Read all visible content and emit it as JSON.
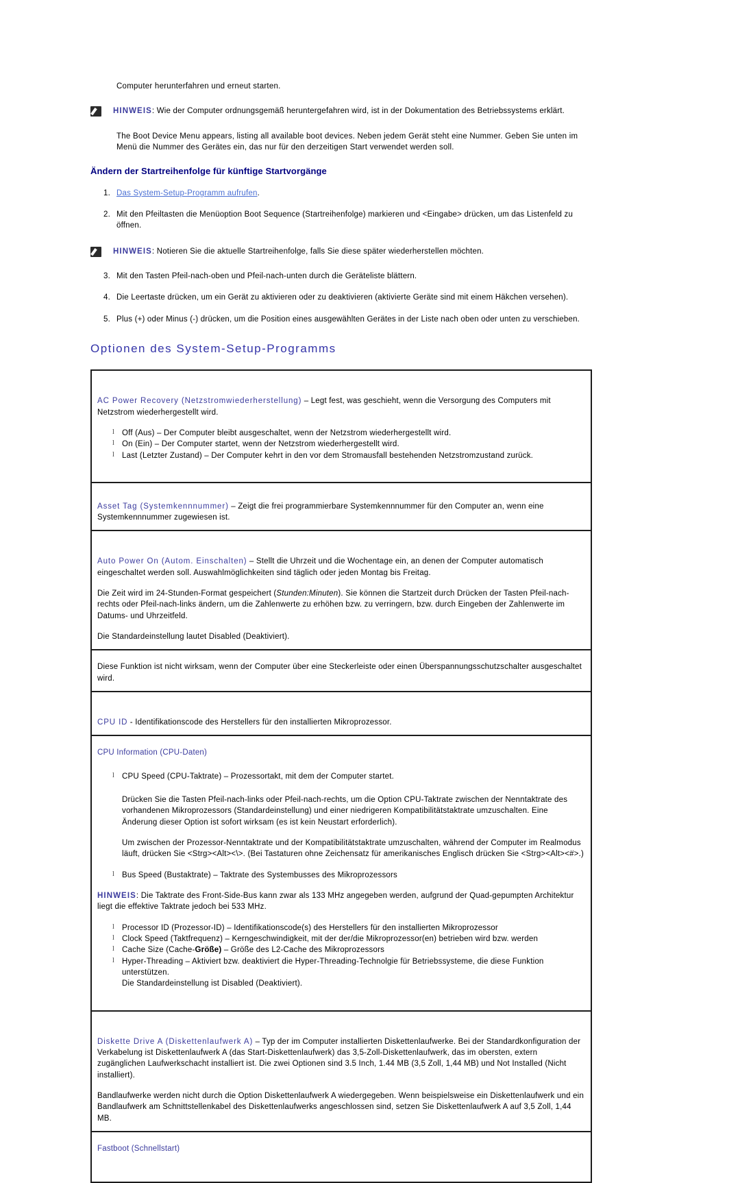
{
  "intro": {
    "shutdown_line": "Computer herunterfahren und erneut starten.",
    "note_label": "HINWEIS",
    "note_1": ": Wie der Computer ordnungsgemäß heruntergefahren wird, ist in der Dokumentation des Betriebssystems erklärt.",
    "boot_menu_para": "The Boot Device Menu appears, listing all available boot devices. Neben jedem Gerät steht eine Nummer. Geben Sie unten im Menü die Nummer des Gerätes ein, das nur für den derzeitigen Start verwendet werden soll."
  },
  "sub_heading": "Ändern der Startreihenfolge für künftige Startvorgänge",
  "steps": [
    {
      "num": "1.",
      "link": "Das System-Setup-Programm aufrufen",
      "after_link": "."
    },
    {
      "num": "2.",
      "text": "Mit den Pfeiltasten die Menüoption Boot Sequence (Startreihenfolge) markieren und <Eingabe> drücken, um das Listenfeld zu öffnen."
    },
    {
      "num": "3.",
      "text": "Mit den Tasten Pfeil-nach-oben und Pfeil-nach-unten durch die Geräteliste blättern."
    },
    {
      "num": "4.",
      "text": "Die Leertaste drücken, um ein Gerät zu aktivieren oder zu deaktivieren (aktivierte Geräte sind mit einem Häkchen versehen)."
    },
    {
      "num": "5.",
      "text": "Plus (+) oder Minus (-) drücken, um die Position eines ausgewählten Gerätes in der Liste nach oben oder unten zu verschieben."
    }
  ],
  "note_2": {
    "label": "HINWEIS",
    "text": ": Notieren Sie die aktuelle Startreihenfolge, falls Sie diese später wiederherstellen möchten."
  },
  "main_heading": "Optionen des System-Setup-Programms",
  "options": {
    "ac_power_recovery": {
      "term": "AC Power Recovery (Netzstromwiederherstellung)",
      "desc": " – Legt fest, was geschieht, wenn die Versorgung des Computers mit Netzstrom wiederhergestellt wird.",
      "bullets": [
        "Off (Aus) – Der Computer bleibt ausgeschaltet, wenn der Netzstrom wiederhergestellt wird.",
        "On (Ein) – Der Computer startet, wenn der Netzstrom wiederhergestellt wird.",
        "Last (Letzter Zustand) – Der Computer kehrt in den vor dem Stromausfall bestehenden Netzstromzustand zurück."
      ]
    },
    "asset_tag": {
      "term": "Asset Tag (Systemkennnummer)",
      "desc": " – Zeigt die frei programmierbare Systemkennnummer für den Computer an, wenn eine Systemkennnummer zugewiesen ist."
    },
    "auto_power_on": {
      "term": "Auto Power On (Autom. Einschalten)",
      "desc": " – Stellt die Uhrzeit und die Wochentage ein, an denen der Computer automatisch eingeschaltet werden soll. Auswahlmöglichkeiten sind täglich oder jeden Montag bis Freitag.",
      "para_time_a": "Die Zeit wird im 24-Stunden-Format gespeichert (",
      "para_time_em": "Stunden:Minuten",
      "para_time_b": "). Sie können die Startzeit durch Drücken der Tasten Pfeil-nach-rechts oder Pfeil-nach-links ändern, um die Zahlenwerte zu erhöhen bzw. zu verringern, bzw. durch Eingeben der Zahlenwerte im Datums- und Uhrzeitfeld.",
      "para_default": "Die Standardeinstellung lautet Disabled (Deaktiviert).",
      "para_surge": "Diese Funktion ist nicht wirksam, wenn der Computer über eine Steckerleiste oder einen Überspannungsschutzschalter ausgeschaltet wird."
    },
    "cpu_id": {
      "term": "CPU ID",
      "desc": " - Identifikationscode des Herstellers für den installierten Mikroprozessor."
    },
    "cpu_information": {
      "term": "CPU Information (CPU-Daten)",
      "bullet_cpu_speed": "CPU Speed (CPU-Taktrate) – Prozessortakt, mit dem der Computer startet.",
      "para_switch_1": "Drücken Sie die Tasten Pfeil-nach-links oder Pfeil-nach-rechts, um die Option CPU-Taktrate zwischen der Nenntaktrate des vorhandenen Mikroprozessors (Standardeinstellung) und einer niedrigeren Kompatibilitätstaktrate umzuschalten. Eine Änderung dieser Option ist sofort wirksam (es ist kein Neustart erforderlich).",
      "para_switch_2": "Um zwischen der Prozessor-Nenntaktrate und der Kompatibilitätstaktrate umzuschalten, während der Computer im Realmodus läuft, drücken Sie <Strg><Alt><\\>. (Bei Tastaturen ohne Zeichensatz für amerikanisches Englisch drücken Sie <Strg><Alt><#>.)",
      "bullet_bus_speed": "Bus Speed (Bustaktrate) – Taktrate des Systembusses des Mikroprozessors",
      "note_label": "HINWEIS",
      "note_text": ": Die Taktrate des Front-Side-Bus kann zwar als 133 MHz angegeben werden, aufgrund der Quad-gepumpten Architektur liegt die effektive Taktrate jedoch bei 533 MHz.",
      "bullets_tail": [
        "Processor ID (Prozessor-ID) – Identifikationscode(s) des Herstellers für den installierten Mikroprozessor",
        "Clock Speed (Taktfrequenz) – Kerngeschwindigkeit, mit der der/die Mikroprozessor(en) betrieben wird bzw. werden"
      ],
      "bullet_cache_a": "Cache Size (Cache-",
      "bullet_cache_bold": "Größe)",
      "bullet_cache_b": " – Größe des L2-Cache des Mikroprozessors",
      "bullet_hyper_1": "Hyper-Threading – Aktiviert bzw. deaktiviert die Hyper-Threading-Technolgie für Betriebssysteme, die diese Funktion unterstützen.",
      "bullet_hyper_2": "Die Standardeinstellung ist Disabled (Deaktiviert)."
    },
    "diskette_drive_a": {
      "term": "Diskette Drive A (Diskettenlaufwerk A)",
      "desc": " – Typ der im Computer installierten Diskettenlaufwerke. Bei der Standardkonfiguration der Verkabelung ist Diskettenlaufwerk A (das Start-Diskettenlaufwerk) das 3,5-Zoll-Diskettenlaufwerk, das im obersten, extern zugänglichen Laufwerkschacht installiert ist. Die zwei Optionen sind 3.5 Inch, 1.44 MB (3,5 Zoll, 1,44 MB) und Not Installed (Nicht installiert).",
      "para_tape": "Bandlaufwerke werden nicht durch die Option Diskettenlaufwerk A wiedergegeben. Wenn beispielsweise ein Diskettenlaufwerk und ein Bandlaufwerk am Schnittstellenkabel des Diskettenlaufwerks angeschlossen sind, setzen Sie Diskettenlaufwerk A auf 3,5 Zoll, 1,44 MB."
    },
    "fastboot": {
      "term": "Fastboot (Schnellstart)"
    }
  },
  "colors": {
    "heading_blue": "#000080",
    "main_heading_blue": "#3333a8",
    "term_blue": "#3b3b9e",
    "link_blue": "#4a6fd4",
    "border_black": "#1b1b1b"
  }
}
